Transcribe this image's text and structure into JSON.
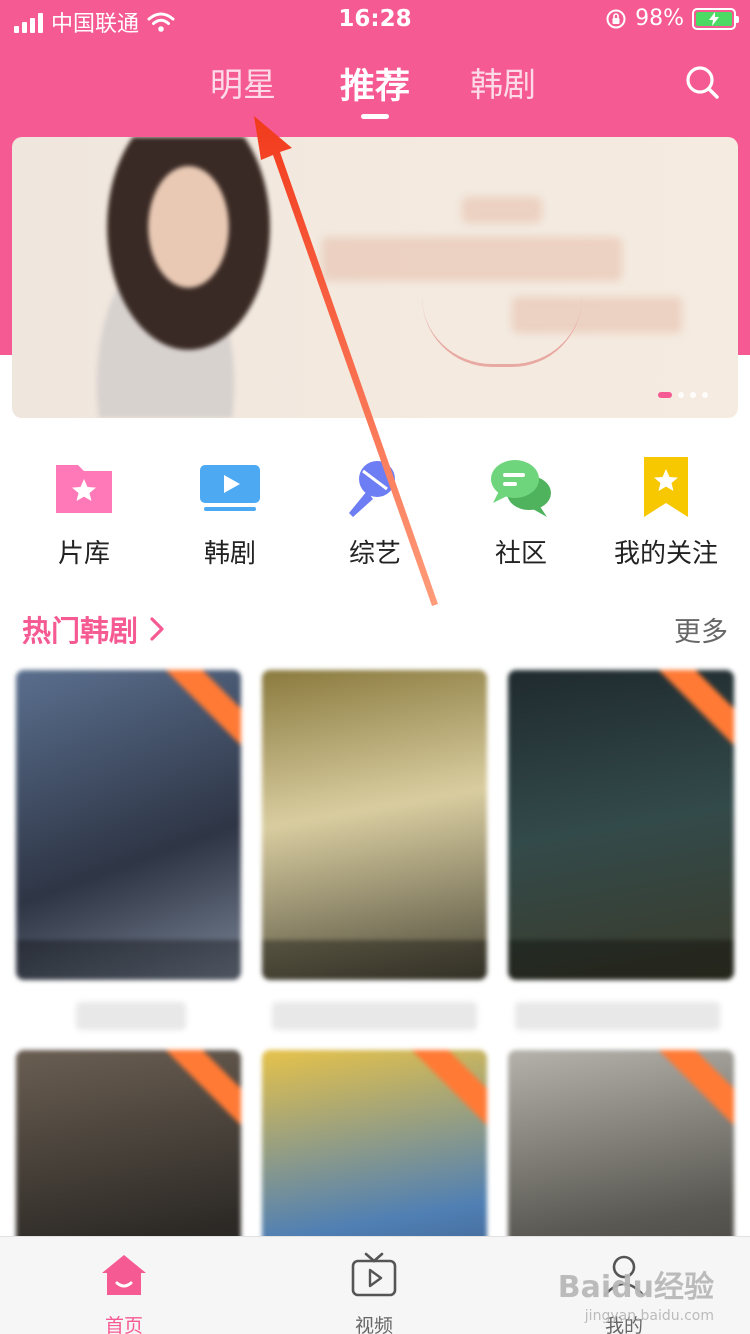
{
  "status_bar": {
    "carrier": "中国联通",
    "time": "16:28",
    "battery": "98%"
  },
  "top_nav": {
    "tabs": [
      {
        "label": "明星"
      },
      {
        "label": "推荐",
        "active": true
      },
      {
        "label": "韩剧"
      }
    ]
  },
  "banner": {
    "slide_count": 4,
    "current_slide": 1
  },
  "categories": [
    {
      "label": "片库",
      "icon": "folder-star-icon",
      "color": "#ff79b8"
    },
    {
      "label": "韩剧",
      "icon": "tv-play-icon",
      "color": "#4ca9f2"
    },
    {
      "label": "综艺",
      "icon": "microphone-icon",
      "color": "#6d7df3"
    },
    {
      "label": "社区",
      "icon": "chat-bubbles-icon",
      "color": "#5cc96a"
    },
    {
      "label": "我的关注",
      "icon": "bookmark-star-icon",
      "color": "#f7c700"
    }
  ],
  "hot_section": {
    "title": "热门韩剧",
    "more": "更多"
  },
  "tabbar": {
    "items": [
      {
        "label": "首页",
        "icon": "home-icon",
        "active": true
      },
      {
        "label": "视频",
        "icon": "tv-play-icon"
      },
      {
        "label": "我的",
        "icon": "user-icon"
      }
    ]
  },
  "watermark": {
    "brand": "Baidu经验",
    "url": "jingyan.baidu.com"
  },
  "colors": {
    "brand_pink": "#f65a92",
    "annotation_arrow": "#f04a1e",
    "ribbon_orange": "#ff7a35"
  }
}
